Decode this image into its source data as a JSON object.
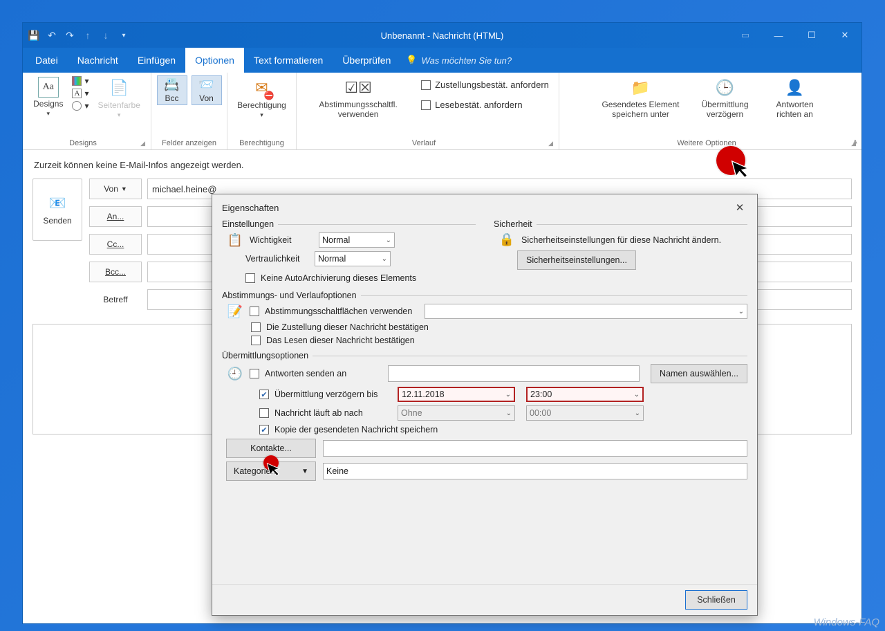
{
  "window": {
    "title": "Unbenannt - Nachricht (HTML)"
  },
  "tabs": {
    "datei": "Datei",
    "nachricht": "Nachricht",
    "einfuegen": "Einfügen",
    "optionen": "Optionen",
    "formatieren": "Text formatieren",
    "ueberpruefen": "Überprüfen",
    "tellme": "Was möchten Sie tun?"
  },
  "ribbon": {
    "designs": {
      "label": "Designs",
      "btn": "Designs",
      "seitenfarbe": "Seitenfarbe"
    },
    "felder": {
      "label": "Felder anzeigen",
      "bcc": "Bcc",
      "von": "Von"
    },
    "berechtigung": {
      "label": "Berechtigung",
      "btn": "Berechtigung"
    },
    "verlauf": {
      "label": "Verlauf",
      "abst": "Abstimmungsschaltfl. verwenden",
      "zustell": "Zustellungsbestät. anfordern",
      "lese": "Lesebestät. anfordern"
    },
    "weitere": {
      "label": "Weitere Optionen",
      "gesendet": "Gesendetes Element speichern unter",
      "verz": "Übermittlung verzögern",
      "antw": "Antworten richten an"
    }
  },
  "compose": {
    "infobar": "Zurzeit können keine E-Mail-Infos angezeigt werden.",
    "senden": "Senden",
    "von": "Von",
    "an": "An...",
    "cc": "Cc...",
    "bcc": "Bcc...",
    "betreff": "Betreff",
    "from_value": "michael.heine@"
  },
  "dialog": {
    "title": "Eigenschaften",
    "settings_legend": "Einstellungen",
    "security_legend": "Sicherheit",
    "importance_label": "Wichtigkeit",
    "importance_value": "Normal",
    "sensitivity_label": "Vertraulichkeit",
    "sensitivity_value": "Normal",
    "no_autoarchive": "Keine AutoArchivierung dieses Elements",
    "security_text": "Sicherheitseinstellungen für diese Nachricht ändern.",
    "security_btn": "Sicherheitseinstellungen...",
    "voting_legend": "Abstimmungs- und Verlaufoptionen",
    "voting_use": "Abstimmungsschaltflächen verwenden",
    "voting_deliver": "Die Zustellung dieser Nachricht bestätigen",
    "voting_read": "Das Lesen dieser Nachricht bestätigen",
    "delivery_legend": "Übermittlungsoptionen",
    "reply_to": "Antworten senden an",
    "select_names": "Namen auswählen...",
    "delay_until": "Übermittlung verzögern bis",
    "delay_date": "12.11.2018",
    "delay_time": "23:00",
    "expires_after": "Nachricht läuft ab nach",
    "expires_date": "Ohne",
    "expires_time": "00:00",
    "save_copy": "Kopie der gesendeten Nachricht speichern",
    "contacts_btn": "Kontakte...",
    "categories_btn": "Kategorien",
    "categories_value": "Keine",
    "close_btn": "Schließen"
  },
  "watermark": "Windows-FAQ"
}
